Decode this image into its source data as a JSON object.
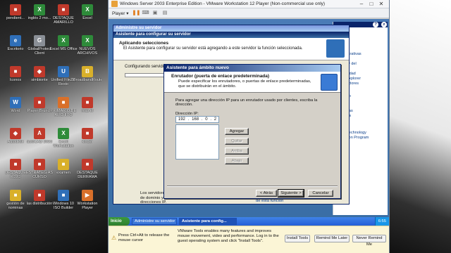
{
  "desktop": {
    "icons": [
      {
        "label": "pendient...",
        "c": "g-red",
        "glyph": "■"
      },
      {
        "label": "inglés 2 mo...",
        "c": "g-grn",
        "glyph": "X"
      },
      {
        "label": "DESTAQUE AMARILLO",
        "c": "g-red",
        "glyph": "■"
      },
      {
        "label": "Excel",
        "c": "g-grn",
        "glyph": "X"
      },
      {
        "label": "Escritorio",
        "c": "g-blu",
        "glyph": "e"
      },
      {
        "label": "GlobalProtect Client",
        "c": "g-gry",
        "glyph": "G"
      },
      {
        "label": "Excel MS Office",
        "c": "g-grn",
        "glyph": "X"
      },
      {
        "label": "NUEVOS ARCHIVOS",
        "c": "g-grn",
        "glyph": "X"
      },
      {
        "label": "Iconos",
        "c": "g-red",
        "glyph": "■"
      },
      {
        "label": "simbionte",
        "c": "g-red",
        "glyph": "◆"
      },
      {
        "label": "Unified FileZip Resto",
        "c": "g-blu",
        "glyph": "U"
      },
      {
        "label": "BroadbandRouter",
        "c": "g-ylw",
        "glyph": "B"
      },
      {
        "label": "Word",
        "c": "g-blu",
        "glyph": "W"
      },
      {
        "label": "Player Brunch",
        "c": "g-red",
        "glyph": "■"
      },
      {
        "label": "PRIMARIO DE ARCHIVO",
        "c": "g-org",
        "glyph": "■"
      },
      {
        "label": "mas el",
        "c": "g-red",
        "glyph": "■"
      },
      {
        "label": "Autodesk",
        "c": "g-red",
        "glyph": "◆"
      },
      {
        "label": "autoCAD 2023",
        "c": "g-red",
        "glyph": "A"
      },
      {
        "label": "Excel Workstation",
        "c": "g-grn",
        "glyph": "X"
      },
      {
        "label": "kinder",
        "c": "g-red",
        "glyph": "■"
      },
      {
        "label": "DESTAQUE ROJO",
        "c": "g-red",
        "glyph": "■"
      },
      {
        "label": "ESTRATEGIAS CURSO",
        "c": "g-red",
        "glyph": "■"
      },
      {
        "label": "examen",
        "c": "g-ylw",
        "glyph": "■"
      },
      {
        "label": "DESTAQUE DERRAMA",
        "c": "g-red",
        "glyph": "■"
      },
      {
        "label": "gestión de nominas",
        "c": "g-ylw",
        "glyph": "■"
      },
      {
        "label": "las distribución",
        "c": "g-red",
        "glyph": "■"
      },
      {
        "label": "Windows 10 ISO Builder",
        "c": "g-blu",
        "glyph": "■"
      },
      {
        "label": "Workstation Player",
        "c": "g-org",
        "glyph": "▶"
      }
    ]
  },
  "player": {
    "title": "Windows Server 2003 Enterprise Edition - VMware Workstation 12 Player (Non-commercial use only)",
    "menu_label": "Player ▾",
    "controls": {
      "minimize": "–",
      "maximize": "□",
      "close": "✕"
    }
  },
  "guest": {
    "back_wizard": {
      "outer_title": "Administre su servidor",
      "title": "Asistente para configurar su servidor",
      "header_title": "Aplicando selecciones",
      "header_subtitle": "El Asistente para configurar su servidor está agregando a este servidor la función seleccionada.",
      "status": "Configurando servidor DHCP..."
    },
    "under_text": "Los servidores DNS traducen los nombres de dominio y DNS de equipo en direcciones IP.",
    "review_text": "Revisar los pasos siguientes de esta función",
    "front_dialog": {
      "title": "Asistente para ámbito nuevo",
      "header_title": "Enrutador (puerta de enlace predeterminada)",
      "header_subtitle": "Puede especificar los enrutadores, o puertas de enlace predeterminadas, que se distribuirán en el ámbito.",
      "instruction": "Para agregar una dirección IP para un enrutador usado por clientes, escriba la dirección.",
      "ip_label": "Dirección IP:",
      "ip_octets": [
        "192",
        "168",
        "0",
        "2"
      ],
      "buttons": {
        "add": "Agregar",
        "remove": "Quitar",
        "up": "Arriba",
        "down": "Abajo",
        "back": "< Atrás",
        "next": "Siguiente >",
        "cancel": "Cancelar"
      }
    },
    "side_panel": {
      "lines_top": [
        "ración",
        "edministrativas",
        "ivos",
        "equipo y del",
        "o",
        "e seguridad",
        "ternet Explorer",
        "de servidores"
      ],
      "header_mid": "ién",
      "lines_mid": [
        "e técnico",
        "ividad",
        "e",
        "nistrativas",
        "Windows",
        "s"
      ],
      "line_bottom1": "ategic Technology",
      "line_bottom2": "Protection Program"
    },
    "taskbar": {
      "start": "Inicio",
      "tasks": [
        "Administre su servidor",
        "Asistente para config..."
      ],
      "clock": "6:55"
    }
  },
  "tools_bar": {
    "hint": "Press Ctrl+Alt to release the mouse cursor",
    "message": "VMware Tools enables many features and improves mouse movement, video and performance. Log in to the guest operating system and click \"Install Tools\".",
    "install": "Install Tools",
    "remind_later": "Remind Me Later",
    "never_remind": "Never Remind Me"
  }
}
